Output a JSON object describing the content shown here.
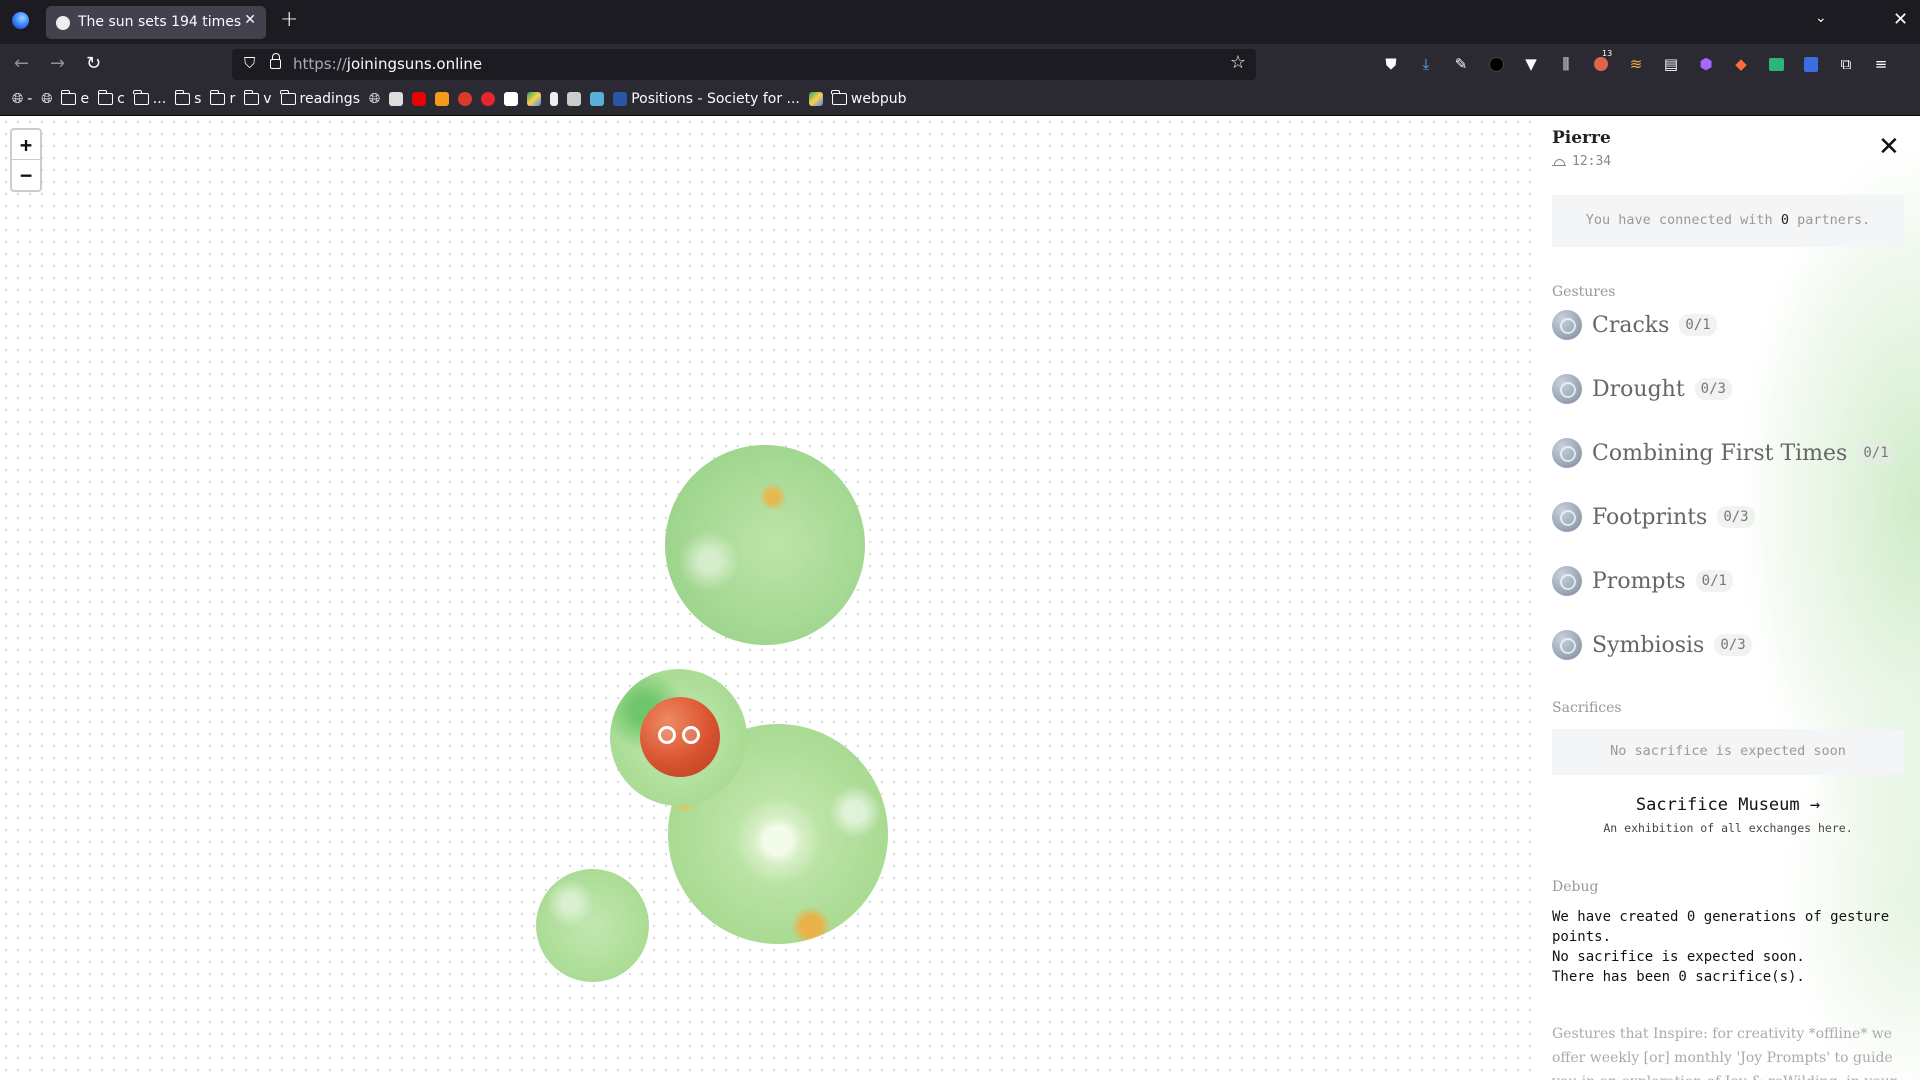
{
  "browser": {
    "tab_title": "The sun sets 194 times",
    "url_protocol": "https://",
    "url_host": "joiningsuns.online",
    "bookmarks": [
      {
        "label": "",
        "icon": "globe-icon"
      },
      {
        "label": "",
        "icon": "globe-icon"
      },
      {
        "label": "e",
        "icon": "folder-icon"
      },
      {
        "label": "c",
        "icon": "folder-icon"
      },
      {
        "label": "...",
        "icon": "folder-icon"
      },
      {
        "label": "s",
        "icon": "folder-icon"
      },
      {
        "label": "r",
        "icon": "folder-icon"
      },
      {
        "label": "v",
        "icon": "folder-icon"
      },
      {
        "label": "readings",
        "icon": "folder-icon"
      },
      {
        "label": "Positions - Society for ...",
        "icon": "site-icon"
      },
      {
        "label": "webpub",
        "icon": "folder-icon"
      }
    ],
    "toolbar_badge": "13"
  },
  "map": {
    "zoom_in": "+",
    "zoom_out": "−"
  },
  "panel": {
    "player_name": "Pierre",
    "time": "12:34",
    "partners_prefix": "You have connected with ",
    "partners_count": "0",
    "partners_suffix": " partners.",
    "gestures_title": "Gestures",
    "gestures": [
      {
        "label": "Cracks",
        "count": "0/1"
      },
      {
        "label": "Drought",
        "count": "0/3"
      },
      {
        "label": "Combining First Times",
        "count": "0/1"
      },
      {
        "label": "Footprints",
        "count": "0/3"
      },
      {
        "label": "Prompts",
        "count": "0/1"
      },
      {
        "label": "Symbiosis",
        "count": "0/3"
      }
    ],
    "sacrifices_title": "Sacrifices",
    "sacrifice_status": "No sacrifice is expected soon",
    "museum_link": "Sacrifice Museum →",
    "museum_subtitle": "An exhibition of all exchanges here.",
    "debug_title": "Debug",
    "debug_lines": [
      "We have created 0 generations of gesture points.",
      "No sacrifice is expected soon.",
      "There has been 0 sacrifice(s)."
    ],
    "inspire_text": "Gestures that Inspire: for creativity *offline* we offer weekly [or] monthly 'Joy Prompts' to guide you in an exploration of Joy & reWilding, in your"
  },
  "colors": {
    "avatar": "#d9532f",
    "blob_green": "#a6d994",
    "chrome_dark": "#1c1b22",
    "chrome_mid": "#2b2a33"
  }
}
